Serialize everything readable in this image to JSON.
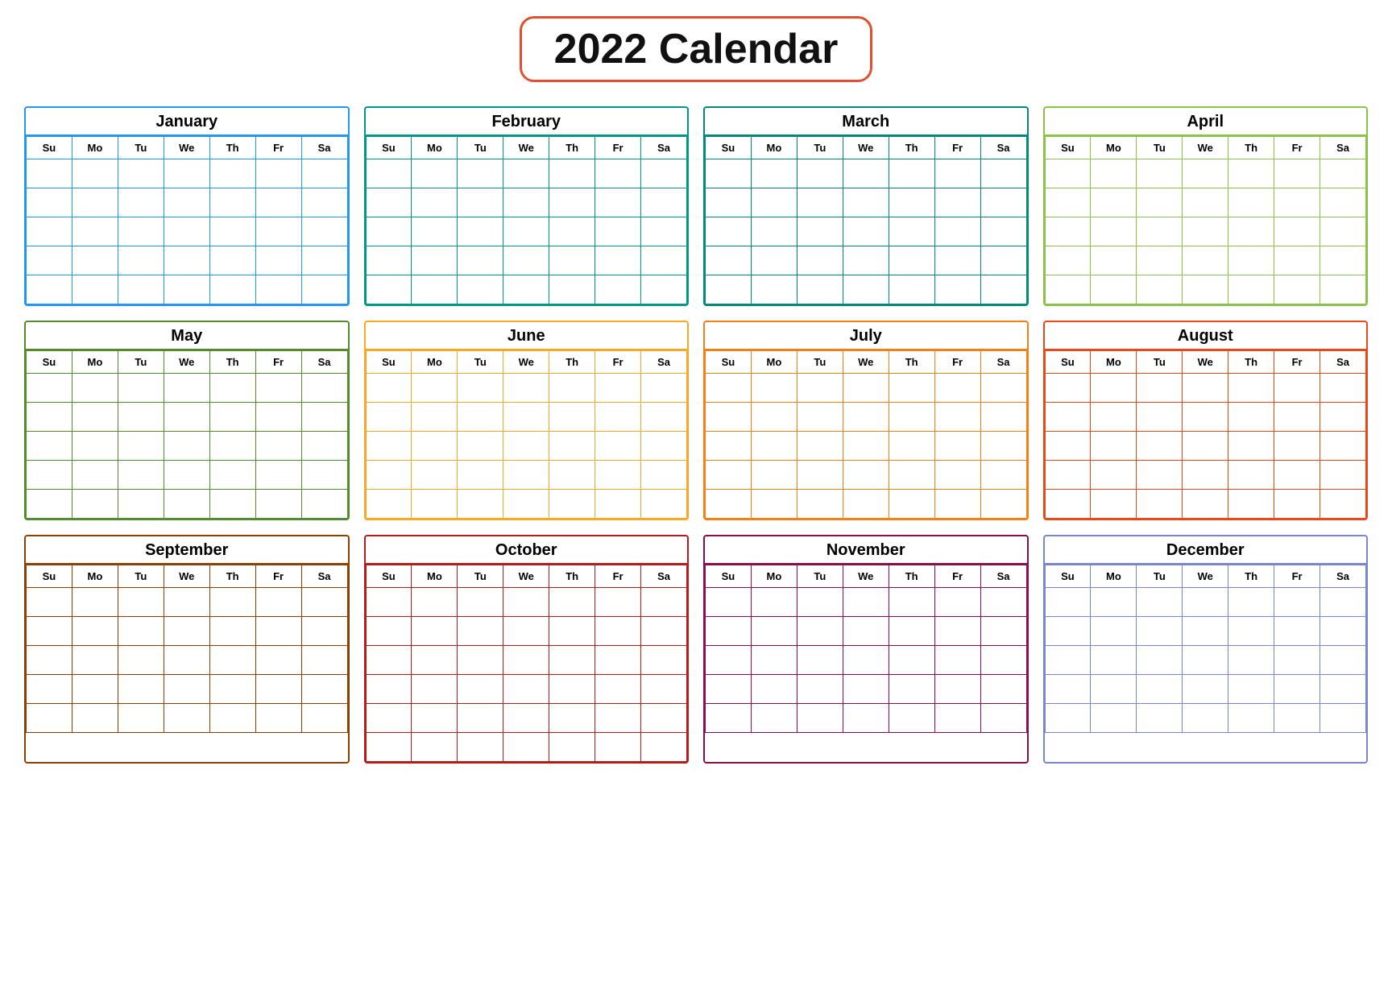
{
  "title": "2022 Calendar",
  "days": [
    "Su",
    "Mo",
    "Tu",
    "We",
    "Th",
    "Fr",
    "Sa"
  ],
  "months": [
    {
      "name": "January",
      "class": "month-jan",
      "rows": 5
    },
    {
      "name": "February",
      "class": "month-feb",
      "rows": 5
    },
    {
      "name": "March",
      "class": "month-mar",
      "rows": 5
    },
    {
      "name": "April",
      "class": "month-apr",
      "rows": 5
    },
    {
      "name": "May",
      "class": "month-may",
      "rows": 5
    },
    {
      "name": "June",
      "class": "month-jun",
      "rows": 5
    },
    {
      "name": "July",
      "class": "month-jul",
      "rows": 5
    },
    {
      "name": "August",
      "class": "month-aug",
      "rows": 5
    },
    {
      "name": "September",
      "class": "month-sep",
      "rows": 5
    },
    {
      "name": "October",
      "class": "month-oct",
      "rows": 6
    },
    {
      "name": "November",
      "class": "month-nov",
      "rows": 5
    },
    {
      "name": "December",
      "class": "month-dec",
      "rows": 5
    }
  ]
}
